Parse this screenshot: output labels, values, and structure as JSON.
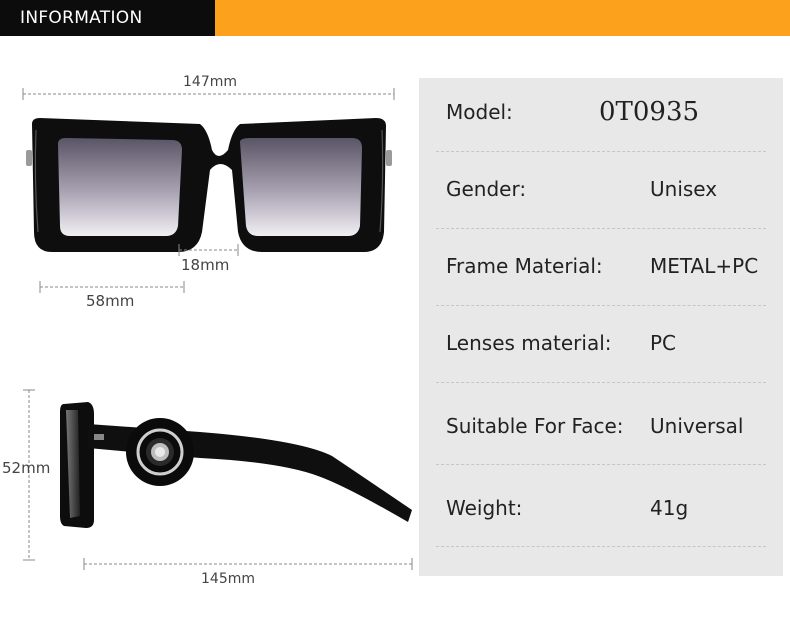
{
  "header": {
    "title": "INFORMATION"
  },
  "dimensions": {
    "total_width": "147mm",
    "bridge": "18mm",
    "lens_width": "58mm",
    "lens_height": "52mm",
    "temple_length": "145mm"
  },
  "specs": [
    {
      "label": "Model:",
      "value": "0T0935"
    },
    {
      "label": "Gender:",
      "value": "Unisex"
    },
    {
      "label": "Frame Material:",
      "value": "METAL+PC"
    },
    {
      "label": "Lenses material:",
      "value": "PC"
    },
    {
      "label": "Suitable For Face:",
      "value": "Universal"
    },
    {
      "label": "Weight:",
      "value": "41g"
    }
  ],
  "colors": {
    "accent": "#fba11b",
    "header_dark": "#0c0c0c",
    "panel": "#e8e8e8"
  }
}
